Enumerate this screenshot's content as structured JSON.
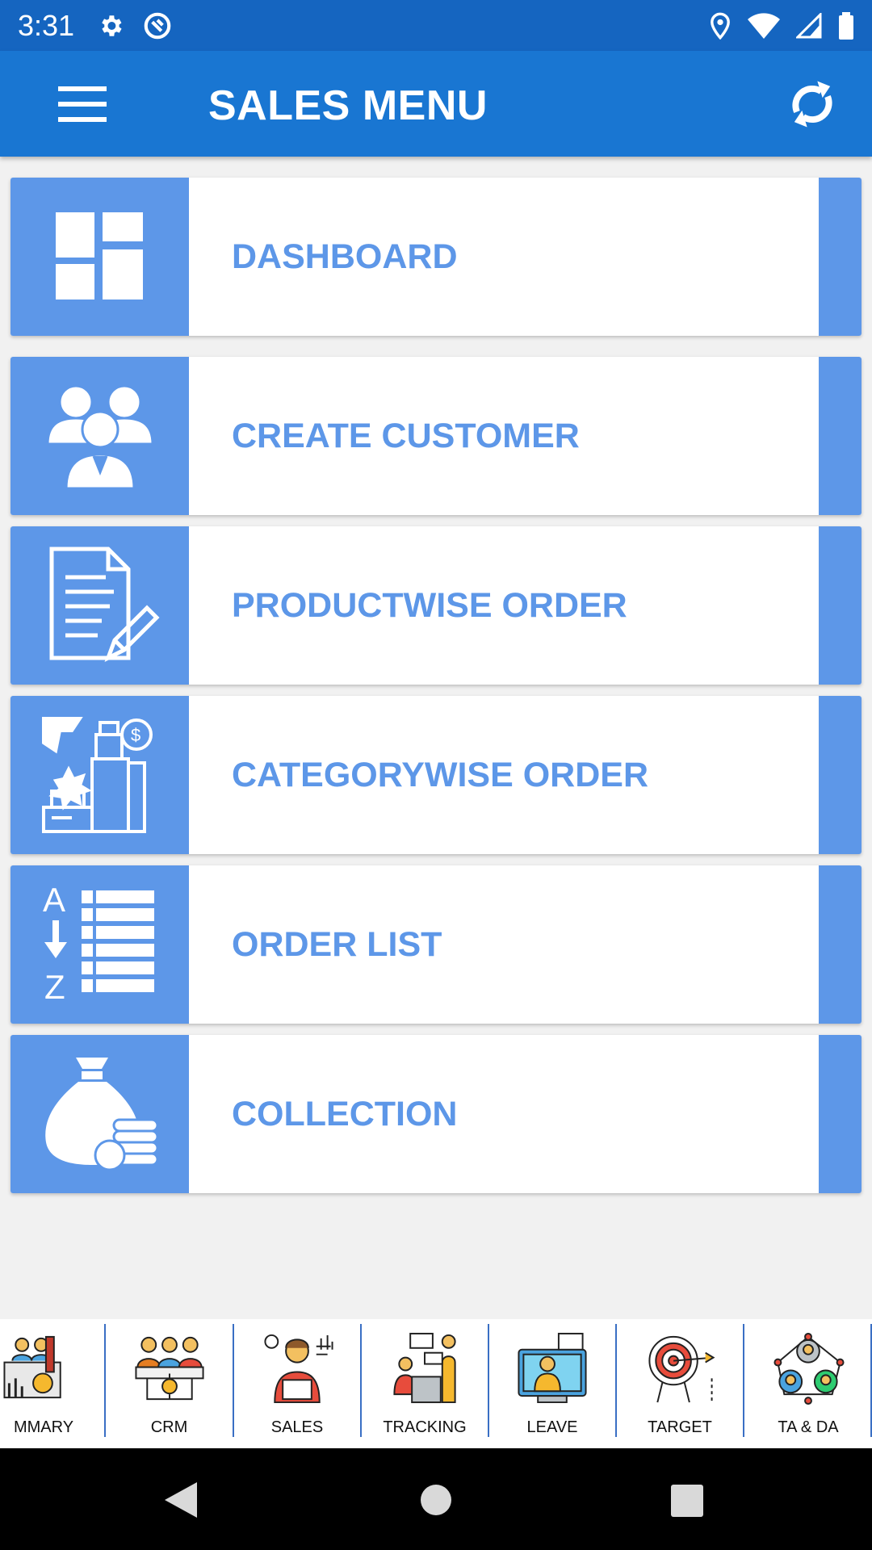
{
  "status_bar": {
    "time": "3:31"
  },
  "app_bar": {
    "title": "SALES MENU"
  },
  "menu": [
    {
      "label": "DASHBOARD",
      "icon": "dashboard-icon"
    },
    {
      "label": "CREATE CUSTOMER",
      "icon": "customers-icon"
    },
    {
      "label": "PRODUCTWISE ORDER",
      "icon": "document-edit-icon"
    },
    {
      "label": "CATEGORYWISE ORDER",
      "icon": "products-category-icon"
    },
    {
      "label": "ORDER LIST",
      "icon": "az-list-icon"
    },
    {
      "label": "COLLECTION",
      "icon": "money-bag-icon"
    }
  ],
  "bottom_nav": [
    {
      "label": "MMARY",
      "icon": "summary-icon"
    },
    {
      "label": "CRM",
      "icon": "crm-icon"
    },
    {
      "label": "SALES",
      "icon": "sales-icon"
    },
    {
      "label": "TRACKING",
      "icon": "tracking-icon"
    },
    {
      "label": "LEAVE",
      "icon": "leave-icon"
    },
    {
      "label": "TARGET",
      "icon": "target-icon"
    },
    {
      "label": "TA & DA",
      "icon": "ta-da-icon"
    }
  ],
  "colors": {
    "status_bar": "#1565c0",
    "app_bar": "#1976d2",
    "accent": "#5d97e8",
    "background": "#f1f1f1"
  }
}
